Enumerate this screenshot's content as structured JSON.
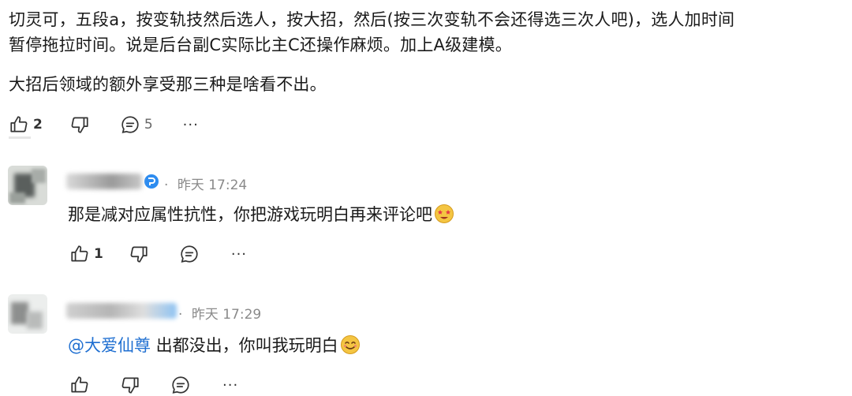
{
  "post": {
    "lines": [
      "切灵可，五段a，按变轨技然后选人，按大招，然后(按三次变轨不会还得选三次人吧)，选人加时间",
      "暂停拖拉时间。说是后台副C实际比主C还操作麻烦。加上A级建模。",
      "大招后领域的额外享受那三种是啥看不出。"
    ],
    "likes": "2",
    "replies": "5",
    "more": "···"
  },
  "replies": [
    {
      "time": "昨天 17:24",
      "separator": "·",
      "text": "那是减对应属性抗性，你把游戏玩明白再来评论吧",
      "emoji": "star-eyes-emoji",
      "likes": "1",
      "more": "···"
    },
    {
      "time": "昨天 17:29",
      "separator": "·",
      "mention": "@大爱仙尊",
      "text": " 出都没出，你叫我玩明白",
      "emoji": "smile-emoji",
      "more": "···"
    }
  ],
  "colors": {
    "accent": "#1f6fd1",
    "verified": "#2d8cf0",
    "muted": "#8a8a8a"
  }
}
